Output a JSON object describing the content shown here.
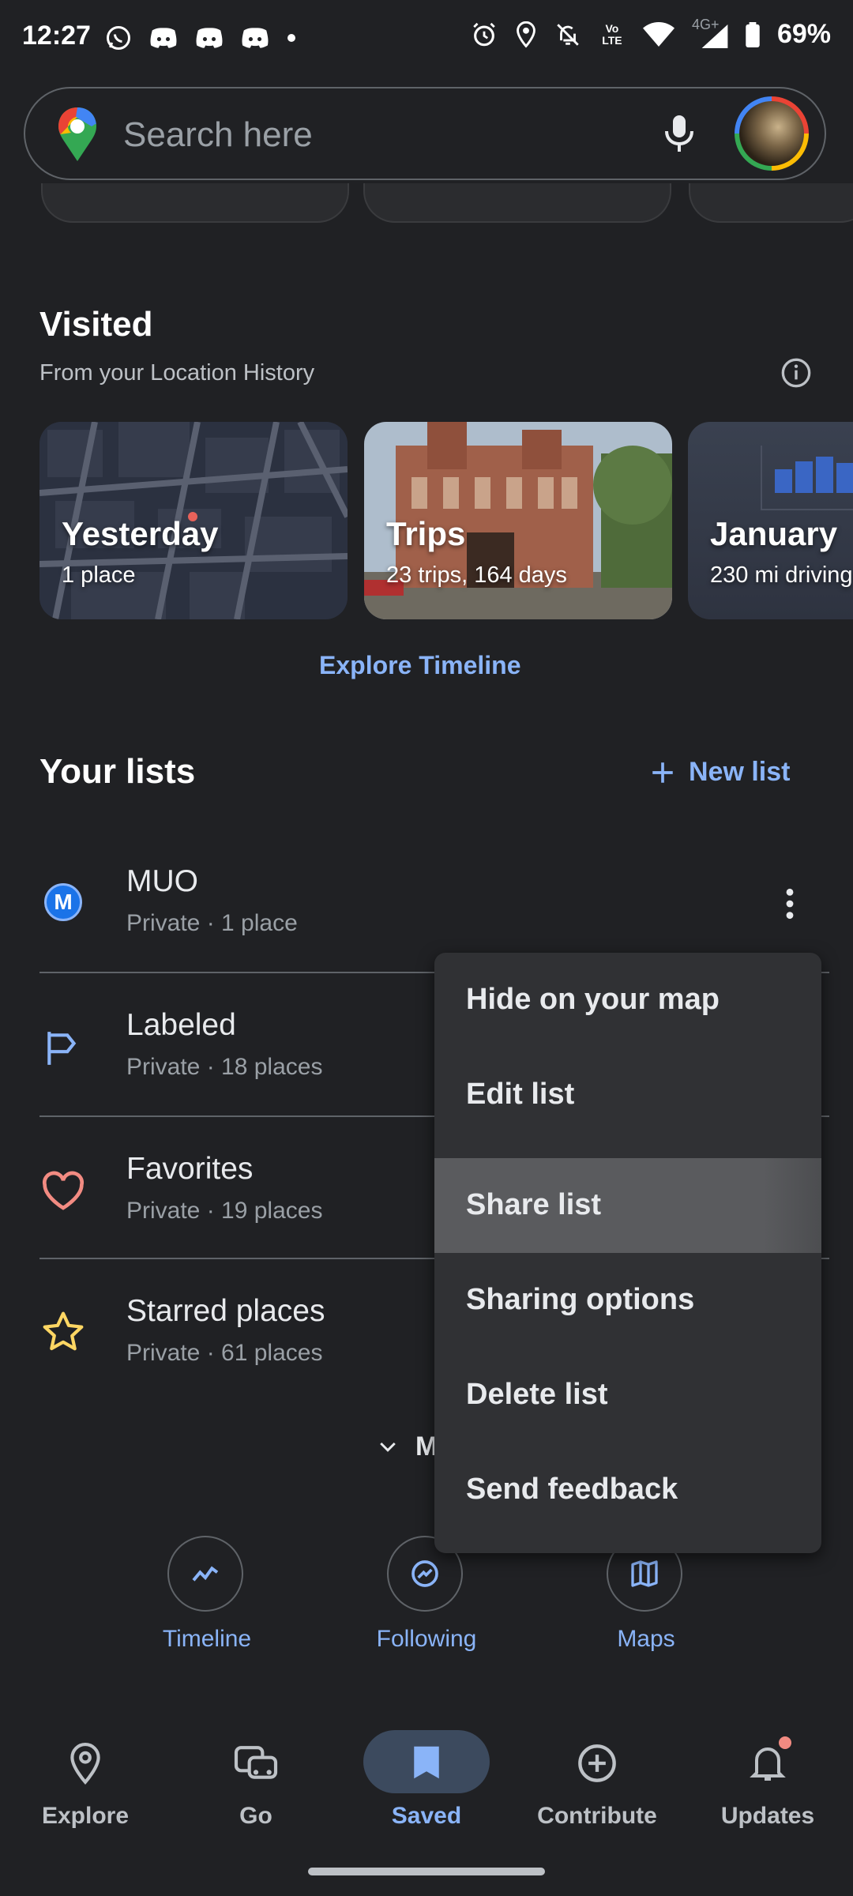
{
  "status": {
    "time": "12:27",
    "battery": "69%",
    "network": "4G+",
    "volte": "Vo LTE"
  },
  "search": {
    "placeholder": "Search here"
  },
  "visited": {
    "title": "Visited",
    "subtitle": "From your Location History",
    "cards": [
      {
        "title": "Yesterday",
        "subtitle": "1 place"
      },
      {
        "title": "Trips",
        "subtitle": "23 trips,  164 days"
      },
      {
        "title": "January",
        "subtitle": "230 mi driving"
      }
    ],
    "explore_link": "Explore Timeline"
  },
  "lists": {
    "title": "Your lists",
    "new_list": "New list",
    "items": [
      {
        "name": "MUO",
        "meta": "Private · 1 place",
        "icon_letter": "M"
      },
      {
        "name": "Labeled",
        "meta": "Private · 18 places"
      },
      {
        "name": "Favorites",
        "meta": "Private · 19 places"
      },
      {
        "name": "Starred places",
        "meta": "Private · 61 places"
      }
    ],
    "more_partial": "M"
  },
  "menu": {
    "items": [
      "Hide on your map",
      "Edit list",
      "Share list",
      "Sharing options",
      "Delete list",
      "Send feedback"
    ],
    "highlighted_index": 2
  },
  "shortcuts": {
    "items": [
      "Timeline",
      "Following",
      "Maps"
    ]
  },
  "bottom_nav": {
    "items": [
      "Explore",
      "Go",
      "Saved",
      "Contribute",
      "Updates"
    ],
    "active": "Saved"
  },
  "colors": {
    "background": "#202124",
    "accent": "#8ab4f8",
    "menu_bg": "#303134",
    "favorites_icon": "#f28b82",
    "starred_icon": "#fdd663",
    "labeled_icon": "#8ab4f8"
  }
}
